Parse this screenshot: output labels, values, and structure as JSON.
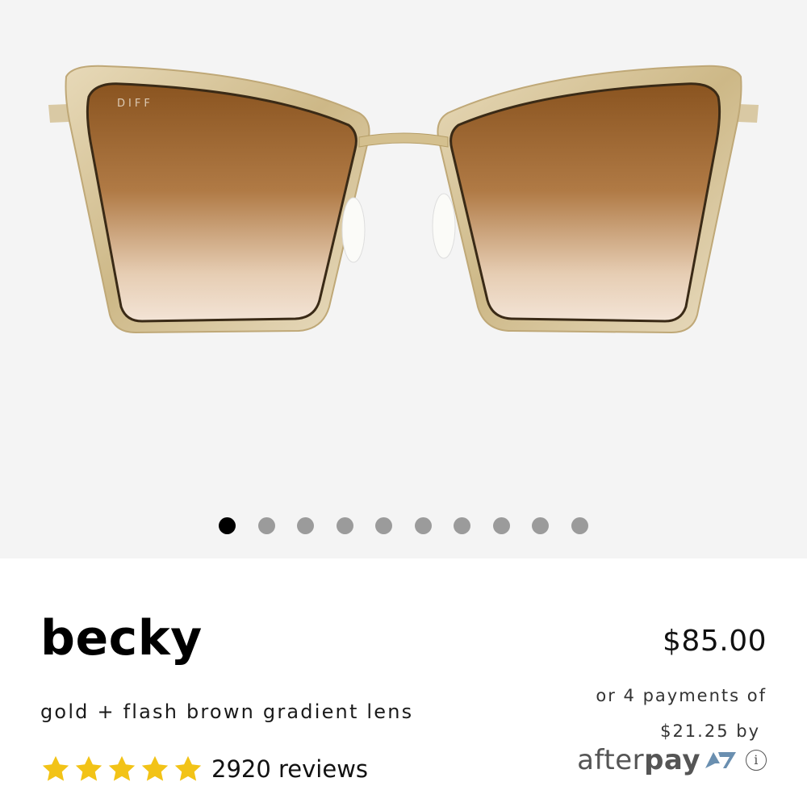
{
  "gallery": {
    "image_alt": "gold cat-eye sunglasses with brown gradient lenses",
    "brand_mark": "DIFF",
    "slide_count": 10,
    "active_slide": 1
  },
  "product": {
    "name": "becky",
    "variant": "gold + flash brown gradient lens",
    "price": "$85.00",
    "rating": {
      "stars": 5,
      "max": 5,
      "review_count_label": "2920 reviews"
    }
  },
  "afterpay": {
    "line1": "or 4 payments of",
    "line2": "$21.25 by",
    "brand_light": "afterpay",
    "brand_bold": "pay",
    "info_glyph": "i",
    "icon": "afterpay-logo-icon"
  },
  "colors": {
    "star": "#f2c317",
    "dot_active": "#000000",
    "dot_inactive": "#9b9b9b",
    "gallery_bg": "#f4f4f4"
  }
}
